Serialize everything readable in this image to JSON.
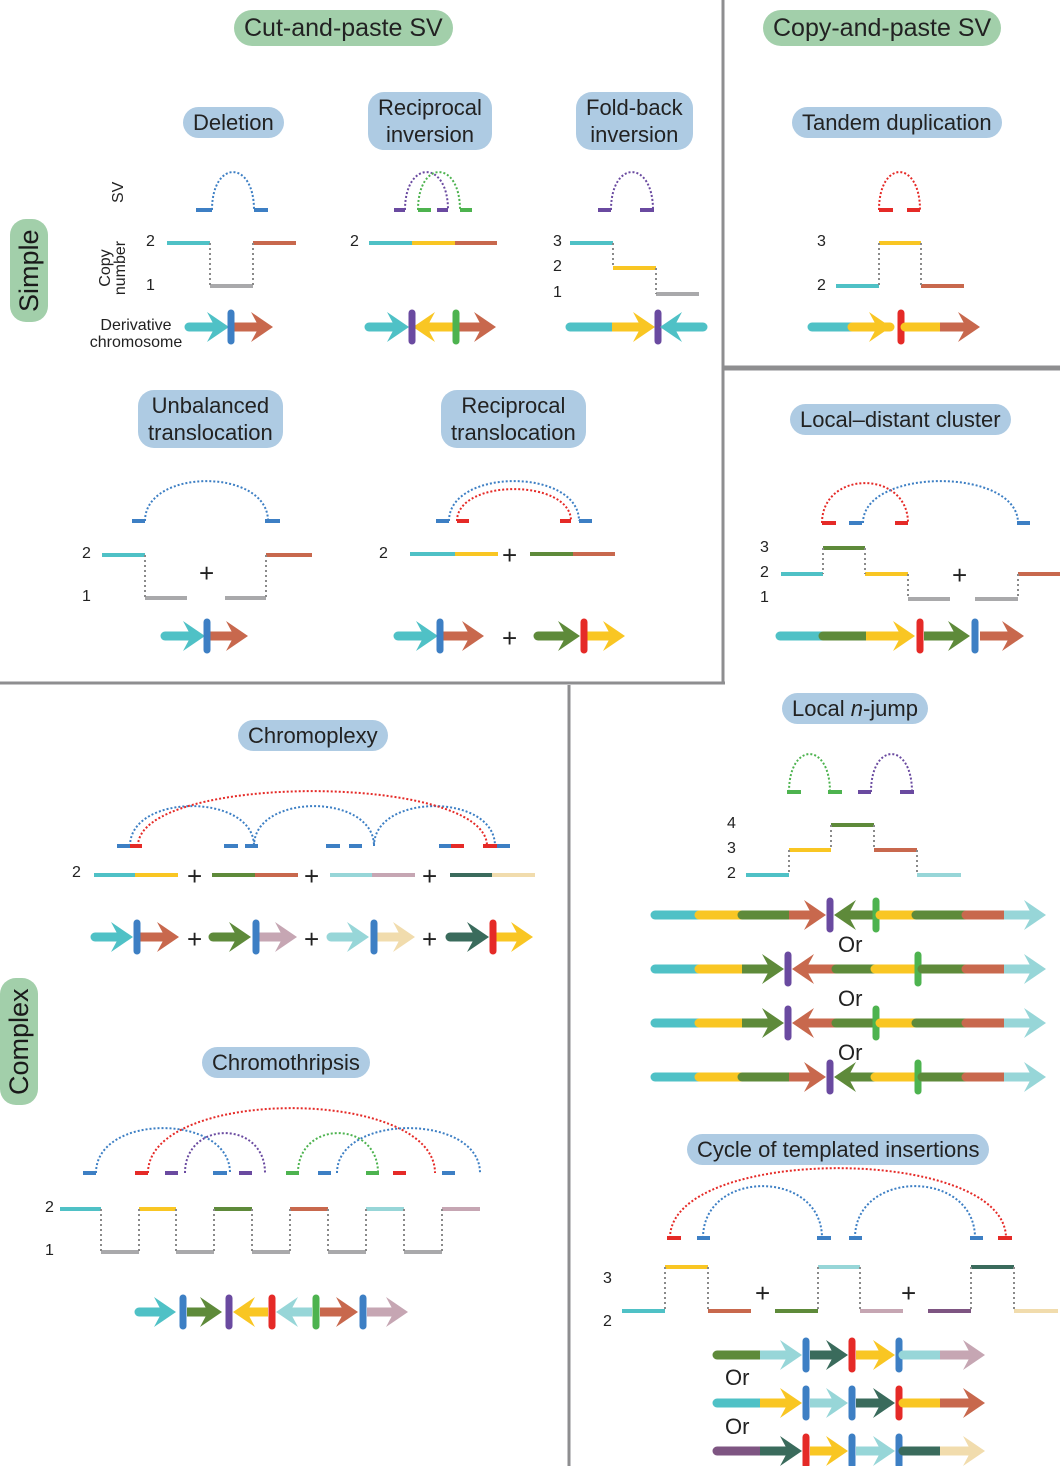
{
  "headers": {
    "cut_paste": "Cut-and-paste SV",
    "copy_paste": "Copy-and-paste SV",
    "simple": "Simple",
    "complex": "Complex"
  },
  "row_labels": {
    "sv": "SV",
    "copy_number": "Copy number",
    "copy_number_line1": "Copy",
    "copy_number_line2": "number",
    "derivative_line1": "Derivative",
    "derivative_line2": "chromosome"
  },
  "colors": {
    "teal": "#4fc1c6",
    "yellow": "#f9c623",
    "rust": "#c8684d",
    "blue": "#3d7fc4",
    "purple": "#6a4aa0",
    "green": "#4db34f",
    "red": "#e52a27",
    "gray": "#a9a9ab",
    "olive": "#5e8a3a",
    "lightteal": "#97d6d8",
    "mauve": "#c6a6b3",
    "darkteal": "#3a6b5c",
    "beige": "#f1dcad",
    "plum": "#7e5582",
    "pill_green": "#a2cfaa",
    "pill_blue": "#aecbe3",
    "divider": "#8e8e90"
  },
  "panels": {
    "deletion": {
      "title": "Deletion",
      "cn_labels": [
        "2",
        "1"
      ]
    },
    "reciprocal_inversion": {
      "title_line1": "Reciprocal",
      "title_line2": "inversion",
      "cn_labels": [
        "2"
      ]
    },
    "foldback_inversion": {
      "title_line1": "Fold-back",
      "title_line2": "inversion",
      "cn_labels": [
        "3",
        "2",
        "1"
      ]
    },
    "tandem_duplication": {
      "title": "Tandem duplication",
      "cn_labels": [
        "3",
        "2"
      ]
    },
    "unbalanced_translocation": {
      "title_line1": "Unbalanced",
      "title_line2": "translocation",
      "cn_labels": [
        "2",
        "1"
      ],
      "plus": "+"
    },
    "reciprocal_translocation": {
      "title_line1": "Reciprocal",
      "title_line2": "translocation",
      "cn_labels": [
        "2"
      ],
      "plus": "+"
    },
    "local_distant_cluster": {
      "title": "Local–distant cluster",
      "cn_labels": [
        "3",
        "2",
        "1"
      ],
      "plus": "+"
    },
    "chromoplexy": {
      "title": "Chromoplexy",
      "cn_labels": [
        "2"
      ],
      "plus": "+"
    },
    "chromothripsis": {
      "title": "Chromothripsis",
      "cn_labels": [
        "2",
        "1"
      ]
    },
    "local_n_jump": {
      "title_pre": "Local ",
      "title_italic": "n",
      "title_post": "-jump",
      "cn_labels": [
        "4",
        "3",
        "2"
      ],
      "or": "Or"
    },
    "cycle_templated": {
      "title": "Cycle of templated insertions",
      "cn_labels": [
        "3",
        "2"
      ],
      "plus": "+",
      "or": "Or"
    }
  }
}
